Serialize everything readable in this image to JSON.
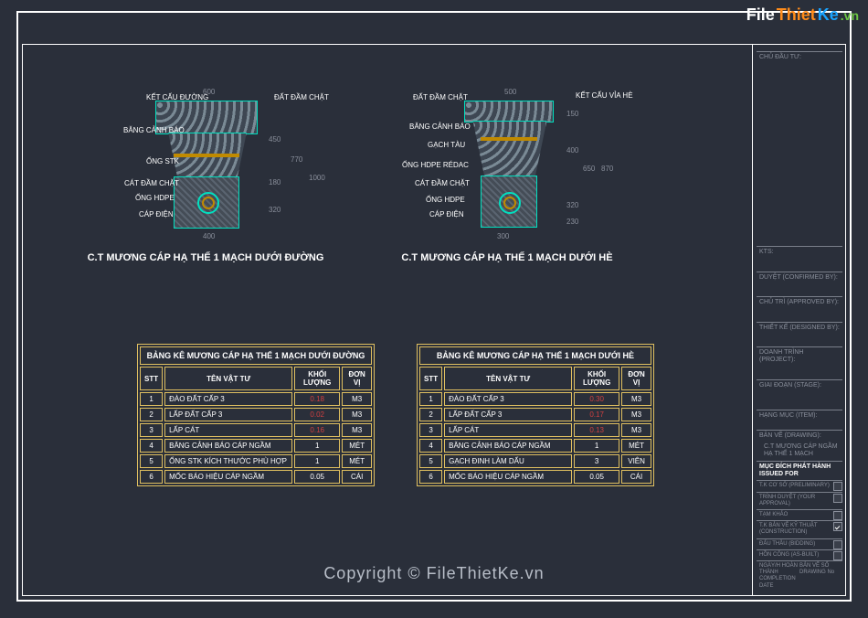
{
  "watermark": {
    "brand_file": "File",
    "brand_thiet": "Thiet",
    "brand_ke": "Ke",
    "brand_vn": ".vn",
    "footer": "Copyright © FileThietKe.vn"
  },
  "drawing1": {
    "title": "C.T MƯƠNG CÁP HẠ THẾ 1 MẠCH DƯỚI ĐƯỜNG",
    "labels": {
      "ketcau": "KẾT CẤU ĐƯỜNG",
      "bangcanhbao": "BĂNG CẢNH BÁO",
      "ongstk": "ỐNG STK",
      "catdam": "CÁT ĐẦM CHẶT",
      "onghdpe": "ỐNG HDPE",
      "capdien": "CÁP ĐIỆN",
      "datdam": "ĐẤT ĐẦM CHẶT"
    },
    "dims": {
      "top": "600",
      "bottom": "400",
      "h1": "450",
      "h2": "180",
      "h3": "320",
      "h4": "1000",
      "total": "770"
    }
  },
  "drawing2": {
    "title": "C.T MƯƠNG CÁP HẠ THẾ 1 MẠCH DƯỚI HÈ",
    "labels": {
      "datdam": "ĐẤT ĐẦM CHẶT",
      "bangcanhbao": "BĂNG CẢNH BÁO",
      "gachtau": "GẠCH TÀU",
      "onghdpereg": "ỐNG HDPE RÉDAC",
      "catdam": "CÁT ĐẦM CHẶT",
      "onghdpe": "ỐNG HDPE",
      "capdien": "CÁP ĐIỆN",
      "ketcau": "KẾT CẤU VỈA HÈ"
    },
    "dims": {
      "top": "500",
      "bottom": "300",
      "h1": "150",
      "h2": "400",
      "h3": "650",
      "h4": "320",
      "h5": "230",
      "total": "870"
    }
  },
  "table1": {
    "title": "BẢNG KÊ MƯƠNG CÁP HẠ THẾ 1 MẠCH DƯỚI ĐƯỜNG",
    "headers": {
      "stt": "STT",
      "ten": "TÊN VẬT TƯ",
      "kl": "KHỐI LƯỢNG",
      "dv": "ĐƠN VỊ"
    },
    "rows": [
      {
        "n": "1",
        "name": "ĐÀO ĐẤT CẤP 3",
        "qty": "0.18",
        "unit": "M3",
        "red": true
      },
      {
        "n": "2",
        "name": "LẤP ĐẤT CẤP 3",
        "qty": "0.02",
        "unit": "M3",
        "red": true
      },
      {
        "n": "3",
        "name": "LẤP CÁT",
        "qty": "0.16",
        "unit": "M3",
        "red": true
      },
      {
        "n": "4",
        "name": "BĂNG CẢNH BÁO CÁP NGẦM",
        "qty": "1",
        "unit": "MÉT",
        "red": false
      },
      {
        "n": "5",
        "name": "ỐNG STK KÍCH THƯỚC PHÙ HỢP",
        "qty": "1",
        "unit": "MÉT",
        "red": false
      },
      {
        "n": "6",
        "name": "MỐC BÁO HIỆU CÁP NGẦM",
        "qty": "0.05",
        "unit": "CÁI",
        "red": false
      }
    ]
  },
  "table2": {
    "title": "BẢNG KÊ MƯƠNG CÁP HẠ THẾ 1 MẠCH DƯỚI HÈ",
    "headers": {
      "stt": "STT",
      "ten": "TÊN VẬT TƯ",
      "kl": "KHỐI LƯỢNG",
      "dv": "ĐƠN VỊ"
    },
    "rows": [
      {
        "n": "1",
        "name": "ĐÀO ĐẤT CẤP 3",
        "qty": "0.30",
        "unit": "M3",
        "red": true
      },
      {
        "n": "2",
        "name": "LẤP ĐẤT CẤP 3",
        "qty": "0.17",
        "unit": "M3",
        "red": true
      },
      {
        "n": "3",
        "name": "LẤP CÁT",
        "qty": "0.13",
        "unit": "M3",
        "red": true
      },
      {
        "n": "4",
        "name": "BĂNG CẢNH BÁO CÁP NGẦM",
        "qty": "1",
        "unit": "MÉT",
        "red": false
      },
      {
        "n": "5",
        "name": "GẠCH ĐINH LÀM DẤU",
        "qty": "3",
        "unit": "VIÊN",
        "red": false
      },
      {
        "n": "6",
        "name": "MỐC BÁO HIỆU CÁP NGẦM",
        "qty": "0.05",
        "unit": "CÁI",
        "red": false
      }
    ]
  },
  "titleblock": {
    "chudau": "CHỦ ĐẦU TƯ:",
    "kts": "KTS:",
    "duyet": "DUYỆT (CONFIRMED BY):",
    "chutri": "CHỦ TRÌ (APPROVED BY):",
    "thietke": "THIẾT KẾ (DESIGNED BY):",
    "doanh": "DOANH TRÌNH (PROJECT):",
    "giadoan": "GIAI ĐOẠN (STAGE):",
    "hangmuc": "HẠNG MỤC (ITEM):",
    "banve": "BẢN VẼ (DRAWING):",
    "banve_name": "C.T MƯƠNG CÁP NGẦM\nHẠ THẾ 1 MẠCH",
    "mucdich": "MỤC ĐÍCH PHÁT HÀNH\nISSUED FOR",
    "items": [
      {
        "label": "T.K CƠ SỞ",
        "label2": "(PRELIMINARY)"
      },
      {
        "label": "TRÌNH DUYỆT (YOUR APPROVAL)",
        "label2": ""
      },
      {
        "label": "TẠM KHẢO",
        "label2": ""
      },
      {
        "label": "T.K BẢN VẼ KỸ THUẬT",
        "label2": "(CONSTRUCTION)",
        "checked": true
      },
      {
        "label": "ĐẤU THẦU\n(BIDDING)",
        "label2": ""
      },
      {
        "label": "HỒN CÔNG",
        "label2": "(AS-BUILT)"
      }
    ],
    "ngayhoanthanh": "NGÀY/H HOÀN THÀNH\nCOMPLETION DATE",
    "banveso": "BẢN VẼ SỐ\nDRAWING No"
  }
}
